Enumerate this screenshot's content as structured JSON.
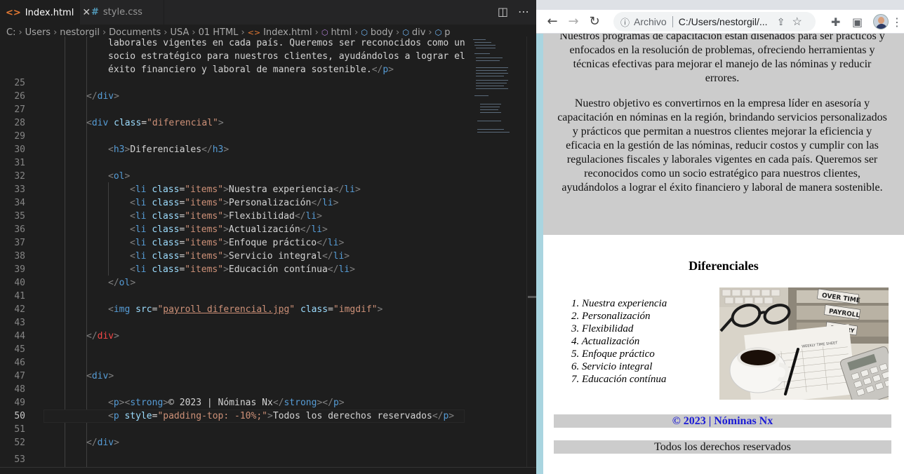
{
  "editor": {
    "tabs": [
      {
        "icon": "<>",
        "label": "Index.html",
        "active": true
      },
      {
        "icon": "#",
        "label": "style.css",
        "active": false
      }
    ],
    "breadcrumb": [
      "C:",
      "Users",
      "nestorgil",
      "Documents",
      "USA",
      "01 HTML",
      "Index.html",
      "html",
      "body",
      "div",
      "p"
    ],
    "wrap_lines": [
      "laborales vigentes en cada país. Queremos ser reconocidos como un",
      "socio estratégico para nuestros clientes, ayudándolos a lograr el",
      "éxito financiero y laboral de manera sostenible."
    ],
    "line_numbers": [
      "25",
      "26",
      "27",
      "28",
      "29",
      "30",
      "31",
      "32",
      "33",
      "34",
      "35",
      "36",
      "37",
      "38",
      "39",
      "40",
      "41",
      "42",
      "43",
      "44",
      "45",
      "46",
      "47",
      "48",
      "49",
      "50",
      "51",
      "52",
      "53"
    ],
    "current_line": "50",
    "class_diferencial": "\"diferencial\"",
    "h3_text": "Diferenciales",
    "li_class": "\"items\"",
    "items": [
      "Nuestra experiencia",
      "Personalización",
      "Flexibilidad",
      "Actualización",
      "Enfoque práctico",
      "Servicio integral",
      "Educación contínua"
    ],
    "img_src": "payroll diferencial.jpg",
    "img_class": "\"imgdif\"",
    "footer_strong": "© 2023 | Nóminas Nx",
    "style_value": "\"padding-top: -10%;\"",
    "footer_text": "Todos los derechos reservados"
  },
  "browser": {
    "omnibox_label": "Archivo",
    "url": "C:/Users/nestorgil/...",
    "page": {
      "paragraph_top": "Nuestros programas de capacitación están diseñados para ser prácticos y enfocados en la resolución de problemas, ofreciendo herramientas y técnicas efectivas para mejorar el manejo de las nóminas y reducir errores.",
      "paragraph_objective": "Nuestro objetivo es convertirnos en la empresa líder en asesoría y capacitación en nóminas en la región, brindando servicios personalizados y prácticos que permitan a nuestros clientes mejorar la eficiencia y eficacia en la gestión de las nóminas, reducir costos y cumplir con las regulaciones fiscales y laborales vigentes en cada país. Queremos ser reconocidos como un socio estratégico para nuestros clientes, ayudándolos a lograr el éxito financiero y laboral de manera sostenible.",
      "dif_title": "Diferenciales",
      "dif_items": [
        "1. Nuestra experiencia",
        "2. Personalización",
        "3. Flexibilidad",
        "4. Actualización",
        "5. Enfoque práctico",
        "6. Servicio integral",
        "7. Educación contínua"
      ],
      "image_labels": [
        "OVER TIME",
        "PAYROLL",
        "SALARY",
        "WEEKLY TIME SHEET"
      ],
      "footer_copyright": "© 2023 | Nóminas Nx",
      "footer_rights": "Todos los derechos reservados"
    }
  },
  "colors": {
    "editor_bg": "#1e1e1e",
    "tag": "#569cd6",
    "attr": "#9cdcfe",
    "string": "#ce9178",
    "page_gray": "#cccccc",
    "frame_blue": "#a9d5e0",
    "footer_blue": "#1a1ad6"
  }
}
